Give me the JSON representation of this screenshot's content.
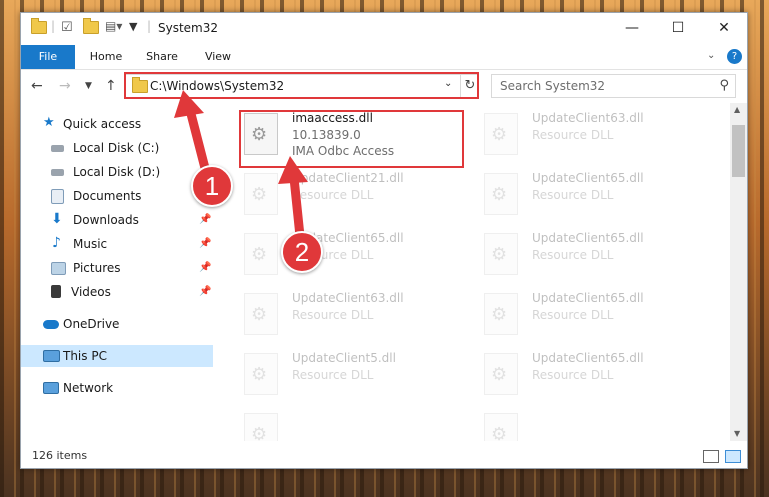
{
  "window": {
    "title": "System32"
  },
  "ribbon": {
    "tabs": [
      "File",
      "Home",
      "Share",
      "View"
    ]
  },
  "address": {
    "path": "C:\\Windows\\System32"
  },
  "search": {
    "placeholder": "Search System32"
  },
  "sidebar": {
    "items": [
      {
        "label": "Quick access",
        "icon": "star-icon",
        "pinned": false
      },
      {
        "label": "Local Disk (C:)",
        "icon": "drive-icon",
        "pinned": false
      },
      {
        "label": "Local Disk (D:)",
        "icon": "drive-icon",
        "pinned": false
      },
      {
        "label": "Documents",
        "icon": "documents-icon",
        "pinned": false
      },
      {
        "label": "Downloads",
        "icon": "download-icon",
        "pinned": true
      },
      {
        "label": "Music",
        "icon": "music-icon",
        "pinned": true
      },
      {
        "label": "Pictures",
        "icon": "pictures-icon",
        "pinned": true
      },
      {
        "label": "Videos",
        "icon": "videos-icon",
        "pinned": true
      },
      {
        "label": "OneDrive",
        "icon": "cloud-icon",
        "pinned": false
      },
      {
        "label": "This PC",
        "icon": "computer-icon",
        "pinned": false
      },
      {
        "label": "Network",
        "icon": "network-icon",
        "pinned": false
      }
    ]
  },
  "files": {
    "primary": {
      "name": "imaaccess.dll",
      "version": "10.13839.0",
      "description": "IMA Odbc Access"
    },
    "ghosts": [
      {
        "name": "UpdateClient63.dll",
        "description": "Resource DLL"
      },
      {
        "name": "UpdateClient21.dll",
        "description": "Resource DLL"
      },
      {
        "name": "UpdateClient65.dll",
        "description": "Resource DLL"
      },
      {
        "name": "UpdateClient65.dll",
        "description": "Resource DLL"
      },
      {
        "name": "UpdateClient65.dll",
        "description": "Resource DLL"
      },
      {
        "name": "UpdateClient63.dll",
        "description": "Resource DLL"
      },
      {
        "name": "UpdateClient65.dll",
        "description": "Resource DLL"
      },
      {
        "name": "UpdateClient5.dll",
        "description": "Resource DLL"
      },
      {
        "name": "UpdateClient65.dll",
        "description": "Resource DLL"
      }
    ]
  },
  "status": {
    "items": "126 items"
  },
  "annotations": {
    "step1": "1",
    "step2": "2",
    "color": "#e0383a"
  }
}
